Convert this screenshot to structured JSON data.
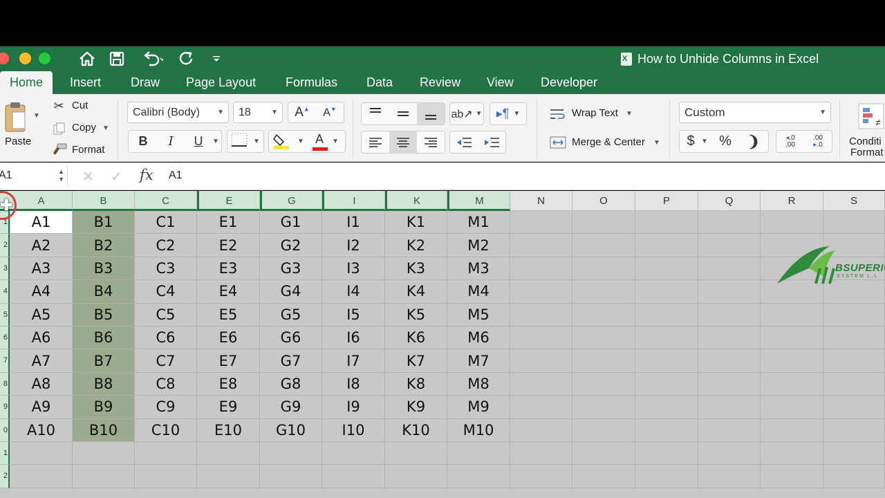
{
  "window": {
    "title": "How to Unhide Columns in Excel"
  },
  "quick_access": {
    "icons": [
      "home-icon",
      "save-icon",
      "undo-icon",
      "redo-icon",
      "customize-icon"
    ]
  },
  "ribbon_tabs": [
    "Home",
    "Insert",
    "Draw",
    "Page Layout",
    "Formulas",
    "Data",
    "Review",
    "View",
    "Developer"
  ],
  "clipboard": {
    "paste": "Paste",
    "cut": "Cut",
    "copy": "Copy",
    "format": "Format"
  },
  "font": {
    "family": "Calibri (Body)",
    "size": "18",
    "bold": "B",
    "italic": "I",
    "underline": "U",
    "font_color": "#e02020",
    "fill_color": "#f5e43a"
  },
  "alignment": {
    "wrap_text": "Wrap Text",
    "merge_center": "Merge & Center"
  },
  "number": {
    "format": "Custom",
    "currency": "$",
    "percent": "%"
  },
  "styles": {
    "conditional_line1": "Conditi",
    "conditional_line2": "Format"
  },
  "formula_bar": {
    "name_box": "A1",
    "fx": "fx",
    "value": "A1"
  },
  "grid": {
    "columns": [
      "A",
      "B",
      "C",
      "E",
      "G",
      "I",
      "K",
      "M",
      "N",
      "O",
      "P",
      "Q",
      "R",
      "S"
    ],
    "row_numbers": [
      "1",
      "2",
      "3",
      "4",
      "5",
      "6",
      "7",
      "8",
      "9",
      "0",
      "1",
      "2"
    ],
    "data_columns": [
      {
        "col": "A",
        "cells": [
          "A1",
          "A2",
          "A3",
          "A4",
          "A5",
          "A6",
          "A7",
          "A8",
          "A9",
          "A10"
        ]
      },
      {
        "col": "B",
        "cells": [
          "B1",
          "B2",
          "B3",
          "B4",
          "B5",
          "B6",
          "B7",
          "B8",
          "B9",
          "B10"
        ]
      },
      {
        "col": "C",
        "cells": [
          "C1",
          "C2",
          "C3",
          "C4",
          "C5",
          "C6",
          "C7",
          "C8",
          "C9",
          "C10"
        ]
      },
      {
        "col": "E",
        "cells": [
          "E1",
          "E2",
          "E3",
          "E4",
          "E5",
          "E6",
          "E7",
          "E8",
          "E9",
          "E10"
        ]
      },
      {
        "col": "G",
        "cells": [
          "G1",
          "G2",
          "G3",
          "G4",
          "G5",
          "G6",
          "G7",
          "G8",
          "G9",
          "G10"
        ]
      },
      {
        "col": "I",
        "cells": [
          "I1",
          "I2",
          "I3",
          "I4",
          "I5",
          "I6",
          "I7",
          "I8",
          "I9",
          "I10"
        ]
      },
      {
        "col": "K",
        "cells": [
          "K1",
          "K2",
          "K3",
          "K4",
          "K5",
          "K6",
          "K7",
          "K8",
          "K9",
          "K10"
        ]
      },
      {
        "col": "M",
        "cells": [
          "M1",
          "M2",
          "M3",
          "M4",
          "M5",
          "M6",
          "M7",
          "M8",
          "M9",
          "M10"
        ]
      }
    ]
  },
  "watermark": {
    "text": "BSUPERIO",
    "sub": "SYSTEM L.L"
  },
  "colors": {
    "excel_green": "#217346",
    "selected_column_fill": "#9bab8e",
    "grid_background": "#c8c8c8"
  }
}
